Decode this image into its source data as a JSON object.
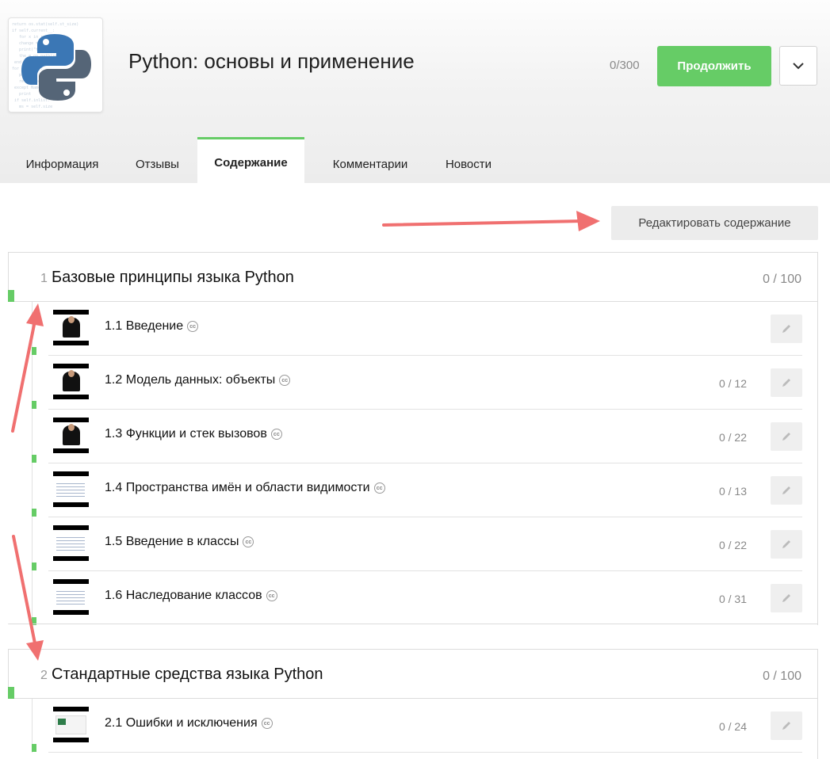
{
  "course": {
    "title": "Python: основы и применение",
    "progress": "0/300",
    "continue_label": "Продолжить"
  },
  "icons": {
    "logo": "python-logo",
    "dropdown": "chevron-down-icon",
    "edit": "pencil-icon",
    "subtitles": "cc-icon"
  },
  "tabs": [
    {
      "label": "Информация",
      "active": false
    },
    {
      "label": "Отзывы",
      "active": false
    },
    {
      "label": "Содержание",
      "active": true
    },
    {
      "label": "Комментарии",
      "active": false
    },
    {
      "label": "Новости",
      "active": false
    }
  ],
  "edit_content_label": "Редактировать содержание",
  "sections": [
    {
      "num": "1",
      "title": "Базовые принципы языка Python",
      "score": "0 / 100",
      "lessons": [
        {
          "title": "1.1 Введение",
          "score": ""
        },
        {
          "title": "1.2 Модель данных: объекты",
          "score": "0 / 12"
        },
        {
          "title": "1.3 Функции и стек вызовов",
          "score": "0 / 22"
        },
        {
          "title": "1.4 Пространства имён и области видимости",
          "score": "0 / 13"
        },
        {
          "title": "1.5 Введение в классы",
          "score": "0 / 22"
        },
        {
          "title": "1.6 Наследование классов",
          "score": "0 / 31"
        }
      ]
    },
    {
      "num": "2",
      "title": "Стандартные средства языка Python",
      "score": "0 / 100",
      "lessons": [
        {
          "title": "2.1 Ошибки и исключения",
          "score": "0 / 24"
        }
      ]
    }
  ],
  "colors": {
    "accent": "#66cc66",
    "arrow": "#f07070"
  }
}
